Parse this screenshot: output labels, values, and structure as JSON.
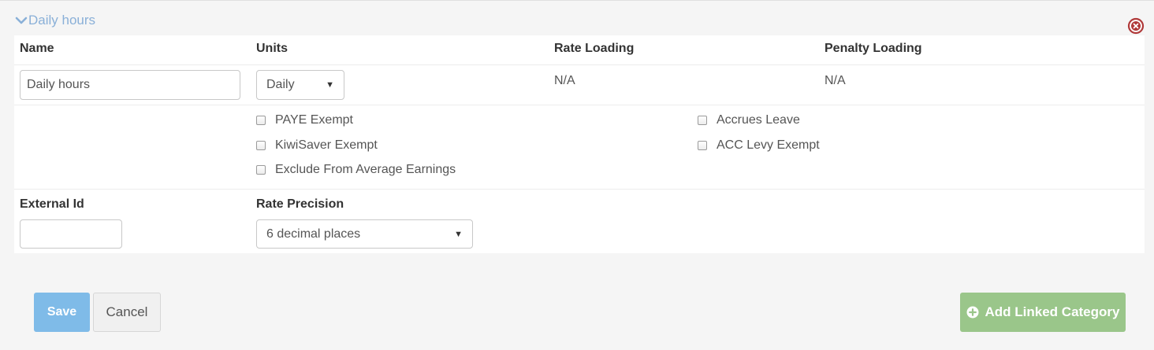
{
  "section": {
    "title": "Daily hours"
  },
  "headers": {
    "name": "Name",
    "units": "Units",
    "rate_loading": "Rate Loading",
    "penalty_loading": "Penalty Loading"
  },
  "fields": {
    "name_value": "Daily hours",
    "units_value": "Daily",
    "rate_loading_value": "N/A",
    "penalty_loading_value": "N/A"
  },
  "checkboxes": [
    {
      "label": "PAYE Exempt",
      "checked": false
    },
    {
      "label": "KiwiSaver Exempt",
      "checked": false
    },
    {
      "label": "Exclude From Average Earnings",
      "checked": false
    },
    {
      "label": "Accrues Leave",
      "checked": false
    },
    {
      "label": "ACC Levy Exempt",
      "checked": false
    }
  ],
  "external": {
    "label": "External Id",
    "value": ""
  },
  "precision": {
    "label": "Rate Precision",
    "value": "6 decimal places"
  },
  "buttons": {
    "save": "Save",
    "cancel": "Cancel",
    "add_linked": "Add Linked Category"
  },
  "colors": {
    "link": "#8ab0d8",
    "save": "#7fbbe8",
    "add": "#9ac68a",
    "remove": "#b03a3a"
  },
  "icons": {
    "collapse": "chevron-down-icon",
    "remove": "circle-x-icon",
    "add": "plus-circle-icon"
  }
}
